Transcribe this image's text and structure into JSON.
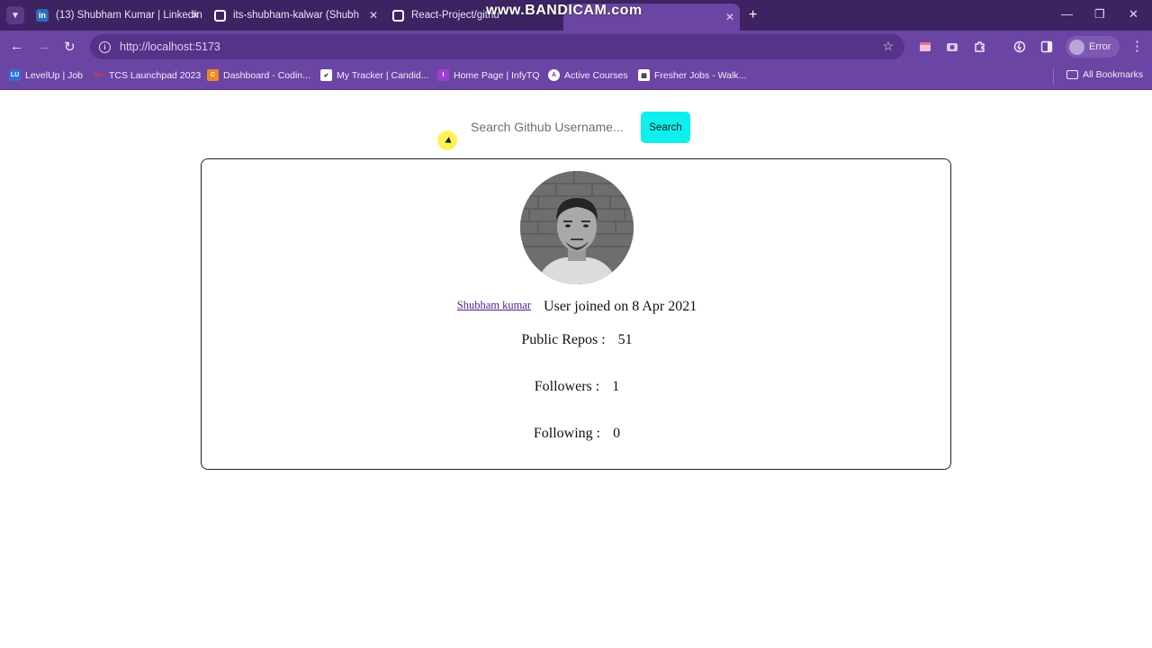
{
  "browser": {
    "tabs": [
      {
        "title": "(13) Shubham Kumar | LinkedIn",
        "icon": "linkedin-icon"
      },
      {
        "title": "its-shubham-kalwar (Shubham",
        "icon": "github-icon"
      },
      {
        "title": "React-Project/githu",
        "icon": "github-icon"
      }
    ],
    "watermark": "www.BANDICAM.com",
    "url": "http://localhost:5173",
    "profile_label": "Error",
    "bookmarks": [
      {
        "label": "LevelUp | Job",
        "icon": "levelup-icon"
      },
      {
        "label": "TCS Launchpad 2023",
        "icon": "tcs-icon"
      },
      {
        "label": "Dashboard - Codin...",
        "icon": "dashboard-icon"
      },
      {
        "label": "My Tracker | Candid...",
        "icon": "tracker-icon"
      },
      {
        "label": "Home Page | InfyTQ",
        "icon": "infytq-icon"
      },
      {
        "label": "Active Courses",
        "icon": "courses-icon"
      },
      {
        "label": "Fresher Jobs - Walk...",
        "icon": "jobs-icon"
      }
    ],
    "all_bookmarks": "All Bookmarks"
  },
  "search": {
    "placeholder": "Search Github Username...",
    "button_label": "Search"
  },
  "profile": {
    "name": "Shubham kumar",
    "joined": "User joined on 8 Apr 2021",
    "stats": [
      {
        "label": "Public Repos :",
        "value": "51"
      },
      {
        "label": "Followers :",
        "value": "1"
      },
      {
        "label": "Following :",
        "value": "0"
      }
    ]
  },
  "colors": {
    "chrome_dark": "#3d2362",
    "chrome": "#6a45a3",
    "search_button": "#0ff0ee"
  }
}
